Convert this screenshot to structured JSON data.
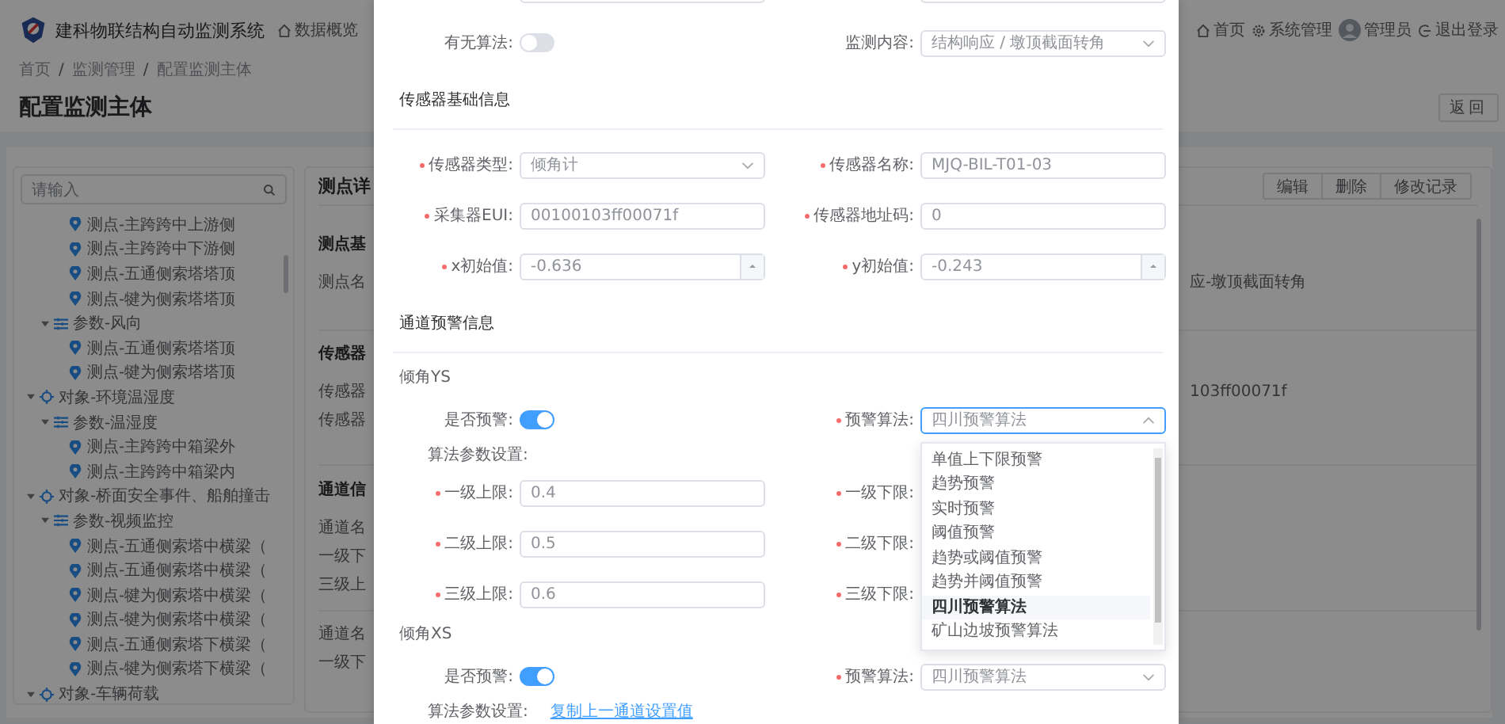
{
  "header": {
    "title": "建科物联结构自动监测系统",
    "nav": [
      {
        "kind": "home",
        "label": "数据概览"
      }
    ],
    "right_nav": [
      {
        "kind": "home",
        "label": "首页"
      },
      {
        "kind": "gear",
        "label": "系统管理"
      },
      {
        "kind": "avatar",
        "label": "管理员"
      },
      {
        "kind": "logout",
        "label": "退出登录"
      }
    ]
  },
  "breadcrumb": {
    "items": [
      "首页",
      "监测管理",
      "配置监测主体"
    ],
    "separator": "/"
  },
  "page_title": "配置监测主体",
  "back_button": "返回",
  "tree": {
    "placeholder": "请输入",
    "nodes": [
      {
        "children": [
          {
            "children": [
              {
                "kind": "point",
                "label": "测点-主跨跨中上游侧"
              },
              {
                "kind": "point",
                "label": "测点-主跨跨中下游侧"
              },
              {
                "kind": "point",
                "label": "测点-五通侧索塔塔顶"
              },
              {
                "kind": "point",
                "label": "测点-犍为侧索塔塔顶"
              }
            ]
          },
          {
            "kind": "param",
            "label": "参数-风向",
            "expanded": true,
            "children": [
              {
                "kind": "point",
                "label": "测点-五通侧索塔塔顶"
              },
              {
                "kind": "point",
                "label": "测点-犍为侧索塔塔顶"
              }
            ]
          }
        ]
      },
      {
        "kind": "object",
        "label": "对象-环境温湿度",
        "expanded": true,
        "children": [
          {
            "kind": "param",
            "label": "参数-温湿度",
            "expanded": true,
            "children": [
              {
                "kind": "point",
                "label": "测点-主跨跨中箱梁外"
              },
              {
                "kind": "point",
                "label": "测点-主跨跨中箱梁内"
              }
            ]
          }
        ]
      },
      {
        "kind": "object",
        "label": "对象-桥面安全事件、船舶撞击",
        "expanded": true,
        "children": [
          {
            "kind": "param",
            "label": "参数-视频监控",
            "expanded": true,
            "children": [
              {
                "kind": "point",
                "label": "测点-五通侧索塔中横梁（"
              },
              {
                "kind": "point",
                "label": "测点-五通侧索塔中横梁（"
              },
              {
                "kind": "point",
                "label": "测点-犍为侧索塔中横梁（"
              },
              {
                "kind": "point",
                "label": "测点-犍为侧索塔中横梁（"
              },
              {
                "kind": "point",
                "label": "测点-五通侧索塔下横梁（"
              },
              {
                "kind": "point",
                "label": "测点-犍为侧索塔下横梁（"
              }
            ]
          }
        ]
      },
      {
        "kind": "object",
        "label": "对象-车辆荷载",
        "expanded": true
      }
    ]
  },
  "detail": {
    "title": "测点详",
    "buttons": [
      "编辑",
      "删除",
      "修改记录"
    ],
    "sections": [
      {
        "title": "测点基",
        "rows": [
          {
            "label": "测点名",
            "value": "应-墩顶截面转角"
          }
        ]
      },
      {
        "title": "传感器",
        "rows": [
          {
            "label": "传感器",
            "value": "103ff00071f"
          },
          {
            "label": "传感器"
          }
        ]
      },
      {
        "title": "通道信",
        "rows": [
          {
            "label": "通道名"
          },
          {
            "label": "一级下"
          },
          {
            "label": "三级上"
          }
        ]
      },
      {
        "rows": [
          {
            "label": "通道名"
          },
          {
            "label": "一级下"
          }
        ]
      }
    ]
  },
  "modal": {
    "blocks": [
      {
        "kind": "pair",
        "fields": [
          {
            "label": "有无算法:",
            "kind": "switch",
            "on": false
          },
          {
            "label": "监测内容:",
            "kind": "select",
            "value": "结构响应 / 墩顶截面转角",
            "open": false
          }
        ]
      },
      {
        "kind": "section",
        "title": "传感器基础信息"
      },
      {
        "kind": "pair",
        "fields": [
          {
            "label": "传感器类型:",
            "required": true,
            "kind": "select",
            "value": "倾角计",
            "open": false
          },
          {
            "label": "传感器名称:",
            "required": true,
            "kind": "input",
            "value": "MJQ-BIL-T01-03"
          }
        ]
      },
      {
        "kind": "pair",
        "fields": [
          {
            "label": "采集器EUI:",
            "required": true,
            "kind": "input",
            "value": "00100103ff00071f"
          },
          {
            "label": "传感器地址码:",
            "required": true,
            "kind": "input",
            "value": "0"
          }
        ]
      },
      {
        "kind": "pair",
        "fields": [
          {
            "label": "x初始值:",
            "required": true,
            "kind": "number",
            "value": "-0.636"
          },
          {
            "label": "y初始值:",
            "required": true,
            "kind": "number",
            "value": "-0.243"
          }
        ]
      },
      {
        "kind": "section",
        "title": "通道预警信息"
      },
      {
        "kind": "group",
        "title": "倾角YS"
      },
      {
        "kind": "pair",
        "fields": [
          {
            "label": "是否预警:",
            "kind": "switch",
            "on": true
          },
          {
            "label": "预警算法:",
            "required": true,
            "kind": "select",
            "value": "四川预警算法",
            "open": true,
            "options": [
              {
                "label": "单值上下限预警",
                "selected": false
              },
              {
                "label": "趋势预警",
                "selected": false
              },
              {
                "label": "实时预警",
                "selected": false
              },
              {
                "label": "阈值预警",
                "selected": false
              },
              {
                "label": "趋势或阈值预警",
                "selected": false
              },
              {
                "label": "趋势并阈值预警",
                "selected": false
              },
              {
                "label": "四川预警算法",
                "selected": true
              },
              {
                "label": "矿山边坡预警算法",
                "selected": false
              }
            ]
          }
        ]
      },
      {
        "kind": "note",
        "label": "算法参数设置:"
      },
      {
        "kind": "pair",
        "fields": [
          {
            "label": "一级上限:",
            "required": true,
            "kind": "input",
            "value": "0.4"
          },
          {
            "label": "一级下限:",
            "required": true
          }
        ]
      },
      {
        "kind": "pair",
        "fields": [
          {
            "label": "二级上限:",
            "required": true,
            "kind": "input",
            "value": "0.5"
          },
          {
            "label": "二级下限:",
            "required": true
          }
        ]
      },
      {
        "kind": "pair",
        "fields": [
          {
            "label": "三级上限:",
            "required": true,
            "kind": "input",
            "value": "0.6"
          },
          {
            "label": "三级下限:",
            "required": true
          }
        ]
      },
      {
        "kind": "group",
        "title": "倾角XS"
      },
      {
        "kind": "pair",
        "fields": [
          {
            "label": "是否预警:",
            "kind": "switch",
            "on": true
          },
          {
            "label": "预警算法:",
            "required": true,
            "kind": "select",
            "value": "四川预警算法",
            "open": false
          }
        ]
      },
      {
        "kind": "note",
        "label": "算法参数设置:",
        "link": "复制上一通道设置值"
      }
    ]
  }
}
